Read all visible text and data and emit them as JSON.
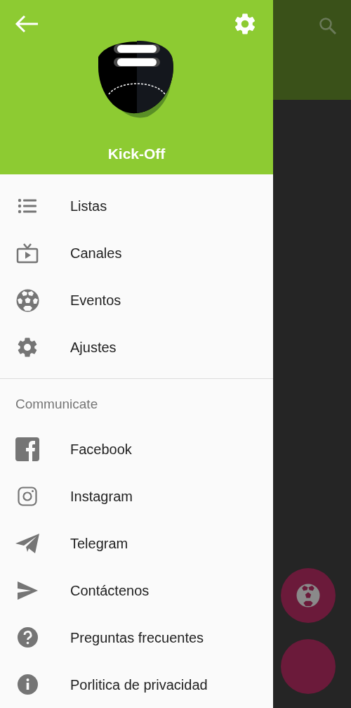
{
  "drawer": {
    "header": {
      "app_name": "Kick-Off"
    },
    "main_items": [
      {
        "label": "Listas"
      },
      {
        "label": "Canales"
      },
      {
        "label": "Eventos"
      },
      {
        "label": "Ajustes"
      }
    ],
    "section": {
      "title": "Communicate"
    },
    "social_items": [
      {
        "label": "Facebook"
      },
      {
        "label": "Instagram"
      },
      {
        "label": "Telegram"
      },
      {
        "label": "Contáctenos"
      },
      {
        "label": "Preguntas frecuentes"
      },
      {
        "label": "Porlitica de privacidad"
      }
    ]
  }
}
